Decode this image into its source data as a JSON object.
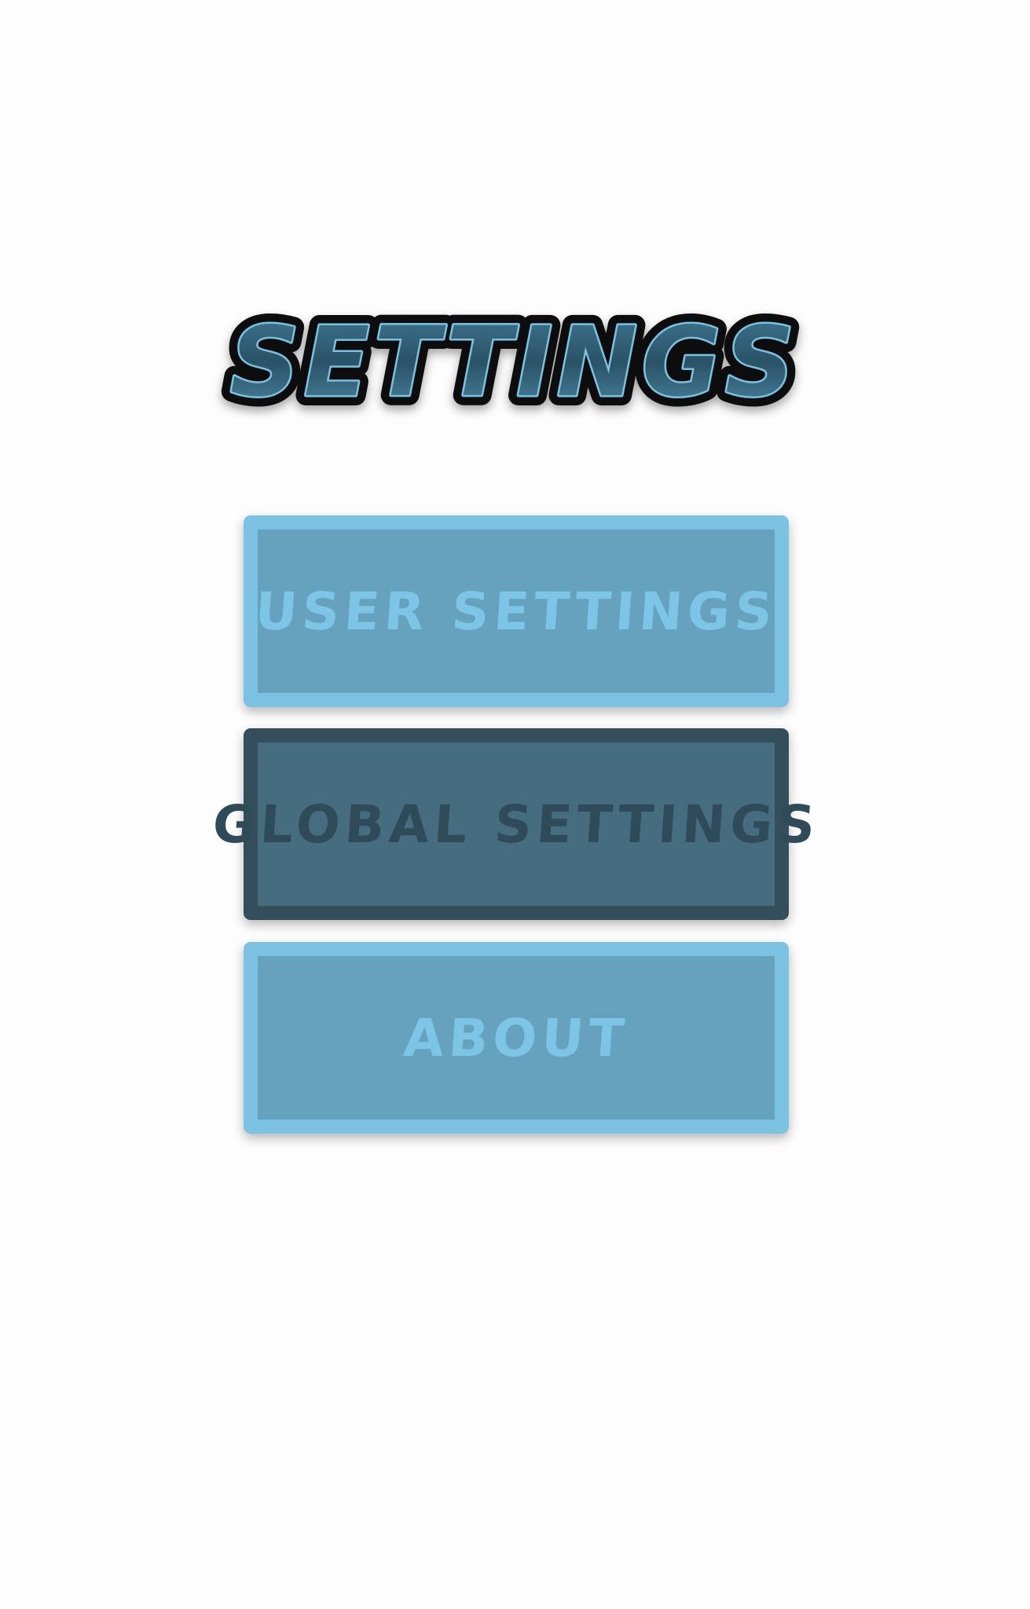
{
  "title": "SETTINGS",
  "menu": {
    "user_settings": "USER SETTINGS",
    "global_settings": "GLOBAL SETTINGS",
    "about": "ABOUT",
    "selected": "global_settings"
  },
  "colors": {
    "background": "#fdfdfd",
    "button_fill": "#66a2be",
    "button_border": "#7cc3e3",
    "selected_fill": "#466c7f",
    "selected_border": "#344e5c",
    "title_outline": "#0b0b0b",
    "title_fill": "#2f5c72",
    "title_edge": "#79c2e2"
  }
}
